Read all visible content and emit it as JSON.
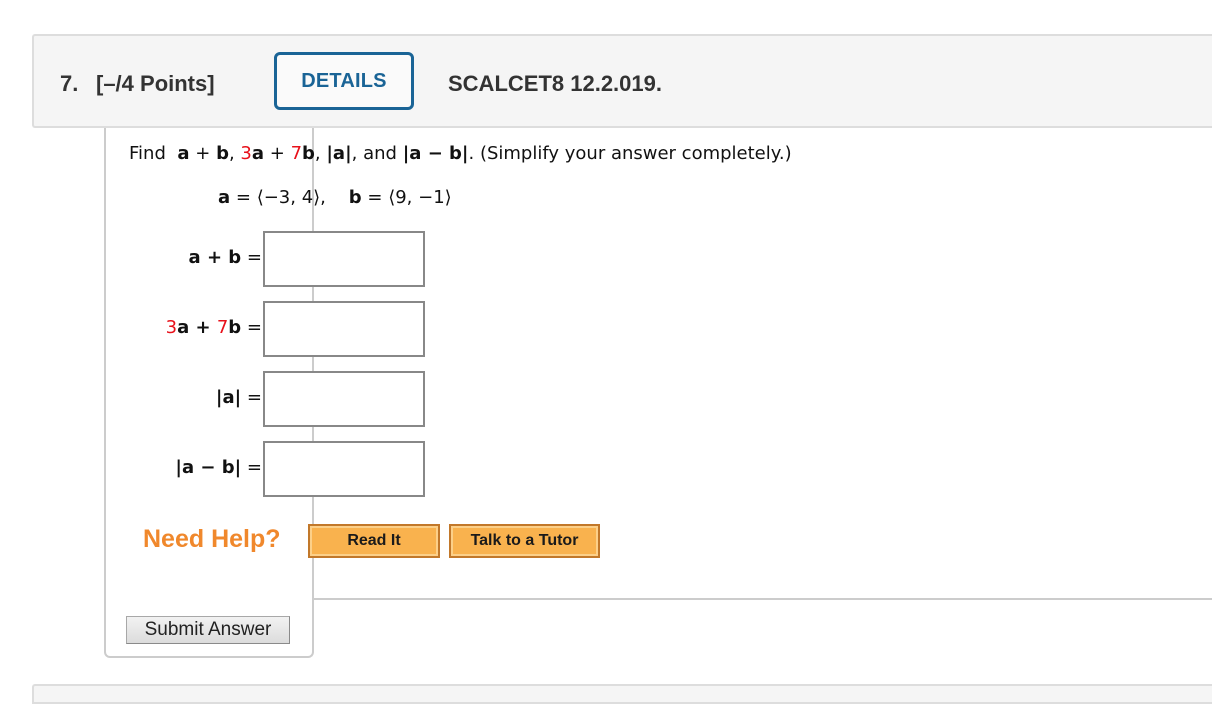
{
  "question": {
    "number": "7.",
    "points": "[–/4 Points]",
    "details_label": "DETAILS",
    "code": "SCALCET8 12.2.019."
  },
  "prompt": {
    "find": "Find",
    "a": "a",
    "plus": "+",
    "b": "b",
    "comma1": ",",
    "coef3": "3",
    "coef7": "7",
    "abs_a": "|a|",
    "and": ", and",
    "abs_a_minus_b": "|a − b|",
    "tail": ". (Simplify your answer completely.)"
  },
  "vectors": {
    "a_name": "a",
    "a_value": "= ⟨−3, 4⟩,",
    "b_name": "b",
    "b_value": "= ⟨9, −1⟩"
  },
  "answers": [
    {
      "label_parts": [
        "",
        "a + b",
        " ="
      ],
      "value": ""
    },
    {
      "label_parts": [
        "3",
        "a + ",
        "7",
        "b",
        " ="
      ],
      "value": ""
    },
    {
      "label": "|a|",
      "eq": " =",
      "value": ""
    },
    {
      "label": "|a − b|",
      "eq": " =",
      "value": ""
    }
  ],
  "help": {
    "label": "Need Help?",
    "read_it": "Read It",
    "tutor": "Talk to a Tutor"
  },
  "submit_label": "Submit Answer",
  "colors": {
    "accent": "#1a6496",
    "highlight_red": "#e8101a",
    "help_orange": "#f0882c",
    "help_button": "#f9b24e"
  }
}
